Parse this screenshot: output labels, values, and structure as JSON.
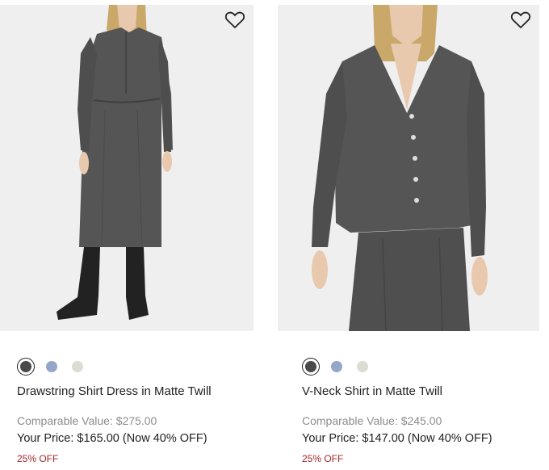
{
  "products": [
    {
      "name": "Drawstring Shirt Dress in Matte Twill",
      "comparable_value": "Comparable Value: $275.00",
      "your_price": "Your Price: $165.00 (Now 40% OFF)",
      "discount_badge": "25% OFF",
      "wishlist_icon": "heart-outline-icon",
      "swatches": [
        {
          "color": "#4a4a4a",
          "selected": true
        },
        {
          "color": "#94a7c9",
          "selected": false
        },
        {
          "color": "#dcdcd2",
          "selected": false
        }
      ]
    },
    {
      "name": "V-Neck Shirt in Matte Twill",
      "comparable_value": "Comparable Value: $245.00",
      "your_price": "Your Price: $147.00 (Now 40% OFF)",
      "discount_badge": "25% OFF",
      "wishlist_icon": "heart-outline-icon",
      "swatches": [
        {
          "color": "#4a4a4a",
          "selected": true
        },
        {
          "color": "#94a7c9",
          "selected": false
        },
        {
          "color": "#dcdcd2",
          "selected": false
        }
      ]
    }
  ]
}
